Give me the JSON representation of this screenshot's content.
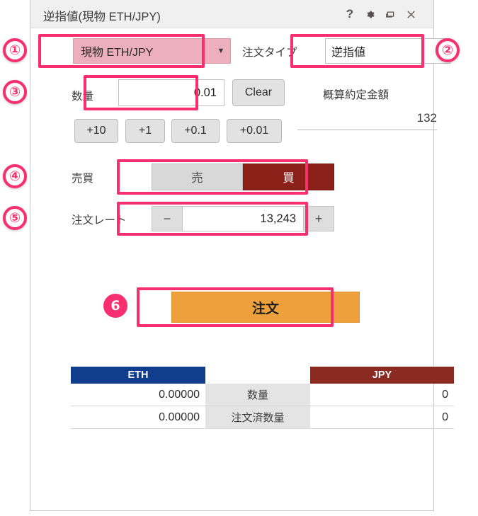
{
  "window": {
    "title": "逆指値(現物 ETH/JPY)",
    "titlebar_icons": [
      {
        "name": "help-icon",
        "glyph": "?"
      },
      {
        "name": "gear-icon",
        "glyph": "✿"
      },
      {
        "name": "restore-icon",
        "glyph": "❐"
      },
      {
        "name": "close-icon",
        "glyph": "✕"
      }
    ]
  },
  "badges": {
    "one": "①",
    "two": "②",
    "three": "③",
    "four": "④",
    "five": "⑤",
    "six": "❻"
  },
  "pair": {
    "value": "現物 ETH/JPY",
    "caret": "▼"
  },
  "order_type": {
    "label": "注文タイプ",
    "value": "逆指値",
    "caret": "▼"
  },
  "quantity": {
    "label": "数量",
    "value": "0.01",
    "clear_label": "Clear",
    "increments": [
      "+10",
      "+1",
      "+0.1",
      "+0.01"
    ]
  },
  "estimate": {
    "label": "概算約定金額",
    "value": "132"
  },
  "side": {
    "label": "売買",
    "sell_label": "売",
    "buy_label": "買",
    "selected": "買"
  },
  "rate": {
    "label": "注文レート",
    "minus": "−",
    "plus": "+",
    "value": "13,243"
  },
  "order_button": {
    "label": "注文"
  },
  "balance_table": {
    "headers": [
      "ETH",
      "",
      "JPY"
    ],
    "rows": [
      {
        "left": "0.00000",
        "mid": "数量",
        "right": "0"
      },
      {
        "left": "0.00000",
        "mid": "注文済数量",
        "right": "0"
      }
    ]
  },
  "colors": {
    "accent_pink": "#f72f6e",
    "pair_fill": "#edafbb",
    "buy_red": "#8b2018",
    "eth_blue": "#103d8c",
    "jpy_red": "#8b2a20",
    "order_orange": "#eda03b"
  }
}
